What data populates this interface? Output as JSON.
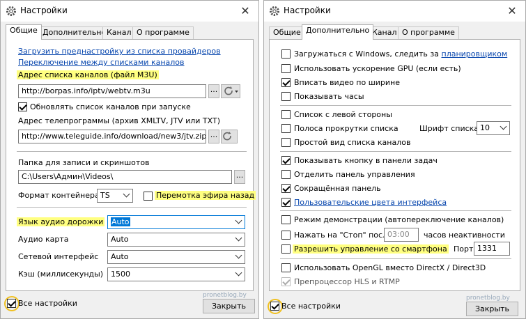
{
  "left_window": {
    "title": "Настройки",
    "close_glyph": "✕",
    "tabs": [
      {
        "label": "Общие",
        "active": true
      },
      {
        "label": "Дополнительно",
        "active": false
      },
      {
        "label": "Канал",
        "active": false
      },
      {
        "label": "О программе",
        "active": false
      }
    ],
    "links": {
      "load_preset": "Загрузить преднастройку из списка провайдеров",
      "switch_lists": "Переключение между списками каналов"
    },
    "channel_list_label": "Адрес списка каналов (файл M3U)",
    "channel_list_value": "http://borpas.info/iptv/webtv.m3u",
    "update_on_start_label": "Обновлять список каналов при запуске",
    "update_on_start_checked": true,
    "epg_label": "Адрес телепрограммы (архив XMLTV, JTV или TXT)",
    "epg_value": "http://www.teleguide.info/download/new3/jtv.zip",
    "record_folder_label": "Папка для записи и скриншотов",
    "record_folder_value": "C:\\Users\\Админ\\Videos\\",
    "container_label": "Формат контейнера",
    "container_value": "TS",
    "timeshift_label": "Перемотка эфира назад",
    "timeshift_checked": false,
    "audio_track_label": "Язык аудио дорожки",
    "audio_track_value": "Auto",
    "audio_card_label": "Аудио карта",
    "audio_card_value": "Auto",
    "network_label": "Сетевой интерфейс",
    "network_value": "Auto",
    "cache_label": "Кэш (миллисекунды)",
    "cache_value": "1500",
    "browse_glyph": "...",
    "all_settings_label": "Все настройки",
    "all_settings_checked": true,
    "close_button": "Закрыть",
    "watermark": "pronetblog.by"
  },
  "right_window": {
    "title": "Настройки",
    "close_glyph": "✕",
    "tabs": [
      {
        "label": "Общие",
        "active": false
      },
      {
        "label": "Дополнительно",
        "active": true
      },
      {
        "label": "Канал",
        "active": false
      },
      {
        "label": "О программе",
        "active": false
      }
    ],
    "options": {
      "autostart_label": "Загружаться с Windows, следить за",
      "autostart_link": "планировщиком",
      "autostart_checked": false,
      "gpu_label": "Использовать ускорение GPU (если есть)",
      "gpu_checked": false,
      "fit_width_label": "Вписать видео по ширине",
      "fit_width_checked": true,
      "clock_label": "Показывать часы",
      "clock_checked": false,
      "left_list_label": "Список с левой стороны",
      "left_list_checked": false,
      "scrollbar_label": "Полоса прокрутки списка",
      "scrollbar_checked": false,
      "simple_list_label": "Простой вид списка каналов",
      "simple_list_checked": false,
      "list_font_label": "Шрифт списка",
      "list_font_value": "10",
      "taskbar_label": "Показывать кнопку в панели задач",
      "taskbar_checked": true,
      "detach_panel_label": "Отделить панель управления",
      "detach_panel_checked": false,
      "compact_panel_label": "Сокращённая панель",
      "compact_panel_checked": true,
      "custom_colors_label": "Пользовательские цвета интерфейса",
      "custom_colors_checked": true,
      "demo_label": "Режим демонстрации (автопереключение каналов)",
      "demo_checked": false,
      "stop_label": "Нажать на \"Стоп\" после",
      "stop_checked": false,
      "stop_time": "03:00",
      "inactivity_label": "часов неактивности",
      "smartphone_label": "Разрешить управление со смартфона",
      "smartphone_checked": false,
      "port_label": "Порт",
      "port_value": "1331",
      "opengl_label": "Использовать OpenGL вместо DirectX / Direct3D",
      "opengl_checked": false,
      "hls_label": "Препроцессор HLS и RTMP",
      "hls_checked": true
    },
    "all_settings_label": "Все настройки",
    "all_settings_checked": true,
    "close_button": "Закрыть",
    "watermark": "pronetblog.by"
  },
  "colors": {
    "highlight": "#ffff80",
    "link": "#0645ad",
    "focus": "#0078d7",
    "footer_ring": "#f0c020"
  }
}
